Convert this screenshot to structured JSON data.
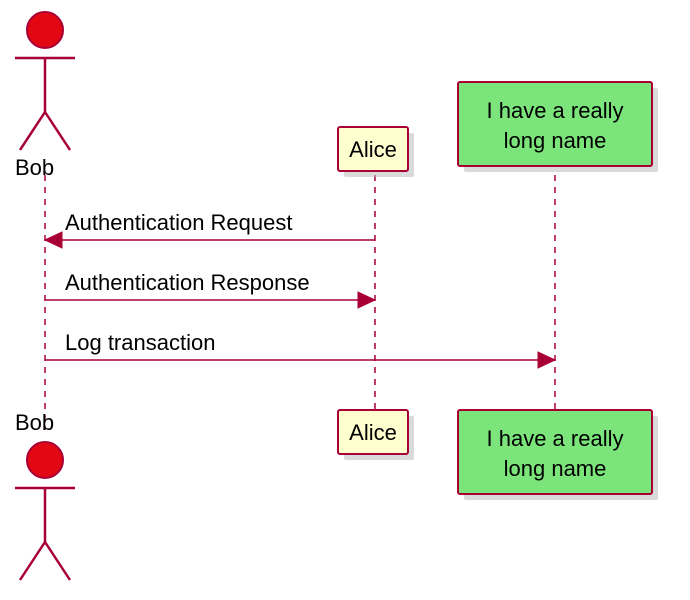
{
  "chart_data": {
    "type": "sequence-diagram",
    "participants": [
      {
        "id": "bob",
        "name": "Bob",
        "kind": "actor"
      },
      {
        "id": "alice",
        "name": "Alice",
        "kind": "participant"
      },
      {
        "id": "long",
        "name": "I have a really long name",
        "kind": "participant",
        "lines": [
          "I have a really",
          "long name"
        ]
      }
    ],
    "messages": [
      {
        "from": "alice",
        "to": "bob",
        "text": "Authentication Request"
      },
      {
        "from": "bob",
        "to": "alice",
        "text": "Authentication Response"
      },
      {
        "from": "bob",
        "to": "long",
        "text": "Log transaction"
      }
    ],
    "colors": {
      "line": "#a80036",
      "actor_fill": "#e30613",
      "participant_fill": "#fefece",
      "long_participant_fill": "#7be57b"
    }
  }
}
